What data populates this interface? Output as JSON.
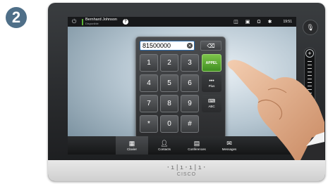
{
  "step_number": "2",
  "status_bar": {
    "user_name": "Bernhard Johnson",
    "user_status": "Disponible",
    "time": "19:51",
    "help_glyph": "?"
  },
  "dialer": {
    "input_value": "81500000",
    "call_label": "APPEL",
    "keys": [
      "1",
      "2",
      "3",
      "4",
      "5",
      "6",
      "7",
      "8",
      "9",
      "*",
      "0",
      "#"
    ],
    "plus_label": "Plus",
    "plus_glyph": "•••",
    "abc_label": "ABC"
  },
  "tabs": [
    {
      "label": "Clavier",
      "icon": "keypad-icon",
      "active": true
    },
    {
      "label": "Contacts",
      "icon": "person-icon",
      "active": false
    },
    {
      "label": "Conférences",
      "icon": "calendar-icon",
      "active": false
    },
    {
      "label": "Messages",
      "icon": "voicemail-icon",
      "active": false
    }
  ],
  "volume_level": 0.55,
  "brand": {
    "bars": "·ı|ı·ı|ı·",
    "name": "CISCO"
  }
}
